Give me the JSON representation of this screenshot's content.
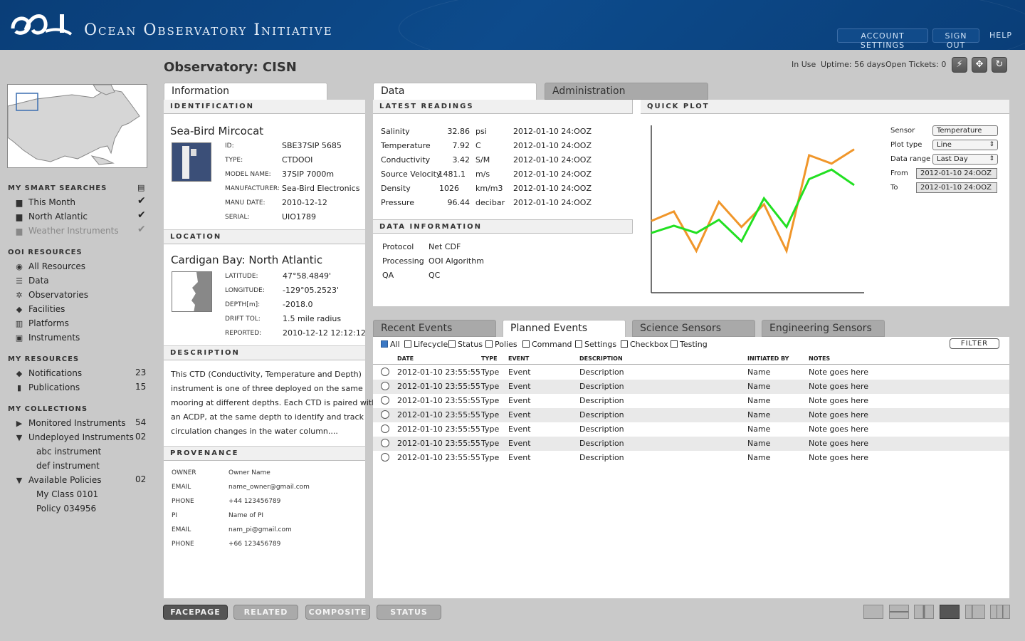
{
  "header": {
    "logo_text": "OOI",
    "app_title": "Ocean Observatory Initiative",
    "account_settings": "ACCOUNT SETTINGS",
    "sign_out": "SIGN OUT",
    "help": "HELP"
  },
  "page": {
    "title": "Observatory: CISN",
    "in_use": "In Use",
    "uptime": "Uptime: 56 days",
    "open_tickets": "Open Tickets: 0"
  },
  "toolbar": {
    "icons": [
      "lightning-icon",
      "crosshair-icon",
      "refresh-icon"
    ]
  },
  "sidebar": {
    "smart_searches_heading": "MY SMART SEARCHES",
    "smart_searches": [
      {
        "label": "This Month"
      },
      {
        "label": "North Atlantic"
      },
      {
        "label": "Weather Instruments"
      }
    ],
    "resources_heading": "OOI RESOURCES",
    "resources": [
      {
        "label": "All Resources",
        "icon": "target-icon"
      },
      {
        "label": "Data",
        "icon": "database-icon"
      },
      {
        "label": "Observatories",
        "icon": "atom-icon"
      },
      {
        "label": "Facilities",
        "icon": "cube-icon"
      },
      {
        "label": "Platforms",
        "icon": "map-icon"
      },
      {
        "label": "Instruments",
        "icon": "instrument-icon"
      }
    ],
    "my_resources_heading": "MY RESOURCES",
    "my_resources": [
      {
        "label": "Notifications",
        "count": "23"
      },
      {
        "label": "Publications",
        "count": "15"
      }
    ],
    "collections_heading": "MY COLLECTIONS",
    "collections": [
      {
        "label": "Monitored Instruments",
        "count": "54"
      },
      {
        "label": "Undeployed Instruments",
        "count": "02"
      },
      {
        "label": "abc instrument"
      },
      {
        "label": "def instrument"
      },
      {
        "label": "Available Policies",
        "count": "02"
      },
      {
        "label": "My Class 0101"
      },
      {
        "label": "Policy 034956"
      }
    ]
  },
  "info_tab": "Information",
  "identification": {
    "heading": "IDENTIFICATION",
    "name": "Sea-Bird Mircocat",
    "fields": [
      {
        "label": "ID:",
        "value": "SBE37SIP 5685"
      },
      {
        "label": "TYPE:",
        "value": "CTDOOI"
      },
      {
        "label": "MODEL NAME:",
        "value": "37SIP 7000m"
      },
      {
        "label": "MANUFACTURER:",
        "value": "Sea-Bird Electronics"
      },
      {
        "label": "MANU DATE:",
        "value": "2010-12-12"
      },
      {
        "label": "SERIAL:",
        "value": "UIO1789"
      }
    ]
  },
  "location": {
    "heading": "LOCATION",
    "name": "Cardigan Bay: North Atlantic",
    "fields": [
      {
        "label": "LATITUDE:",
        "value": "47°58.4849'"
      },
      {
        "label": "LONGITUDE:",
        "value": "-129°05.2523'"
      },
      {
        "label": "DEPTH[m]:",
        "value": "-2018.0"
      },
      {
        "label": "DRIFT TOL:",
        "value": "1.5 mile radius"
      },
      {
        "label": "REPORTED:",
        "value": "2010-12-12 12:12:12"
      }
    ]
  },
  "description": {
    "heading": "DESCRIPTION",
    "lines": [
      "This CTD (Conductivity, Temperature and Depth)",
      "instrument is one of three deployed on the same",
      "mooring at different depths.  Each CTD is paired with",
      "an ACDP, at the same depth to identify and track",
      "circulation changes in the water column...."
    ]
  },
  "provenance": {
    "heading": "PROVENANCE",
    "fields": [
      {
        "label": "OWNER",
        "value": "Owner Name"
      },
      {
        "label": "EMAIL",
        "value": "name_owner@gmail.com"
      },
      {
        "label": "PHONE",
        "value": "+44 123456789"
      },
      {
        "label": "PI",
        "value": "Name of PI"
      },
      {
        "label": "EMAIL",
        "value": "nam_pi@gmail.com"
      },
      {
        "label": "PHONE",
        "value": "+66 123456789"
      }
    ]
  },
  "data_tabs": [
    "Data",
    "Administration"
  ],
  "latest_readings": {
    "heading": "LATEST READINGS",
    "rows": [
      {
        "name": "Salinity",
        "value": "32.86",
        "unit": "psi",
        "time": "2012-01-10 24:OOZ"
      },
      {
        "name": "Temperature",
        "value": "7.92",
        "unit": "C",
        "time": "2012-01-10 24:OOZ"
      },
      {
        "name": "Conductivity",
        "value": "3.42",
        "unit": "S/M",
        "time": "2012-01-10 24:OOZ"
      },
      {
        "name": "Source Velocity",
        "value": "1481.1",
        "unit": "m/s",
        "time": "2012-01-10 24:OOZ"
      },
      {
        "name": "Density",
        "value": "1026",
        "unit": "km/m3",
        "time": "2012-01-10 24:OOZ"
      },
      {
        "name": "Pressure",
        "value": "96.44",
        "unit": "decibar",
        "time": "2012-01-10 24:OOZ"
      }
    ]
  },
  "data_information": {
    "heading": "DATA INFORMATION",
    "rows": [
      {
        "label": "Protocol",
        "value": "Net CDF"
      },
      {
        "label": "Processing",
        "value": "OOI Algorithm"
      },
      {
        "label": "QA",
        "value": "QC"
      }
    ]
  },
  "quick_plot": {
    "heading": "QUICK PLOT",
    "controls": [
      {
        "label": "Sensor",
        "value": "Temperature"
      },
      {
        "label": "Plot type",
        "value": "Line"
      },
      {
        "label": "Data range",
        "value": "Last Day"
      },
      {
        "label": "From",
        "value": "2012-01-10 24:OOZ"
      },
      {
        "label": "To",
        "value": "2012-01-10 24:OOZ"
      }
    ]
  },
  "chart_data": {
    "type": "line",
    "x": [
      0,
      1,
      2,
      3,
      4,
      5,
      6,
      7,
      8,
      9
    ],
    "series": [
      {
        "color": "#f0962a",
        "values": [
          60,
          68,
          35,
          76,
          55,
          74,
          35,
          115,
          108,
          120
        ]
      },
      {
        "color": "#22e022",
        "values": [
          50,
          56,
          50,
          61,
          43,
          79,
          55,
          95,
          103,
          90
        ]
      }
    ],
    "ylim": [
      0,
      140
    ],
    "xlim": [
      0,
      9
    ],
    "grid": false
  },
  "events": {
    "tabs": [
      "Recent Events",
      "Planned Events",
      "Science Sensors",
      "Engineering Sensors"
    ],
    "filters": [
      {
        "label": "All",
        "checked": true
      },
      {
        "label": "Lifecycle"
      },
      {
        "label": "Status"
      },
      {
        "label": "Polies"
      },
      {
        "label": "Command"
      },
      {
        "label": "Settings"
      },
      {
        "label": "Checkbox"
      },
      {
        "label": "Testing"
      }
    ],
    "filter_button": "FILTER",
    "columns": [
      "DATE",
      "TYPE",
      "EVENT",
      "DESCRIPTION",
      "INITIATED BY",
      "NOTES"
    ],
    "rows": [
      [
        "2012-01-10 23:55:55",
        "Type",
        "Event",
        "Description",
        "Name",
        "Note goes here"
      ],
      [
        "2012-01-10 23:55:55",
        "Type",
        "Event",
        "Description",
        "Name",
        "Note goes here"
      ],
      [
        "2012-01-10 23:55:55",
        "Type",
        "Event",
        "Description",
        "Name",
        "Note goes here"
      ],
      [
        "2012-01-10 23:55:55",
        "Type",
        "Event",
        "Description",
        "Name",
        "Note goes here"
      ],
      [
        "2012-01-10 23:55:55",
        "Type",
        "Event",
        "Description",
        "Name",
        "Note goes here"
      ],
      [
        "2012-01-10 23:55:55",
        "Type",
        "Event",
        "Description",
        "Name",
        "Note goes here"
      ],
      [
        "2012-01-10 23:55:55",
        "Type",
        "Event",
        "Description",
        "Name",
        "Note goes here"
      ]
    ]
  },
  "bottom": {
    "buttons": [
      "FACEPAGE",
      "RELATED",
      "COMPOSITE",
      "STATUS"
    ],
    "layout_icons": [
      "layout-single-icon",
      "layout-split-h-icon",
      "layout-split-v-icon",
      "layout-grid-icon",
      "layout-sidebar-icon",
      "layout-columns-icon"
    ]
  }
}
